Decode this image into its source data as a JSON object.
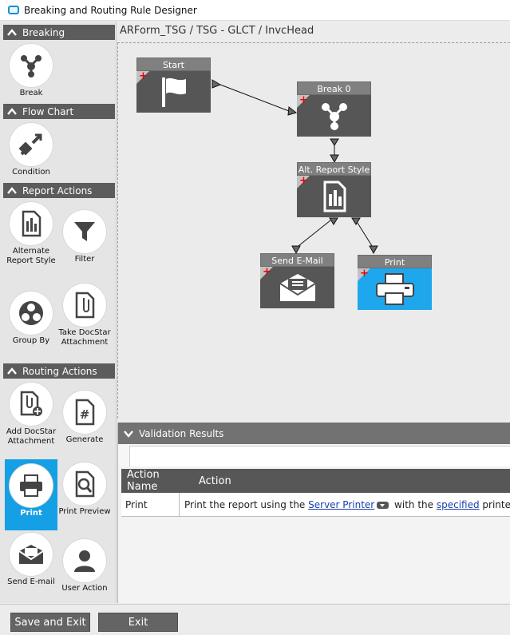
{
  "window": {
    "title": "Breaking and Routing Rule Designer"
  },
  "breadcrumb": "ARForm_TSG / TSG - GLCT / InvcHead",
  "sections": {
    "breaking": "Breaking",
    "flow_chart": "Flow Chart",
    "report_actions": "Report Actions",
    "routing_actions": "Routing Actions"
  },
  "tools": {
    "break": "Break",
    "condition": "Condition",
    "alternate_report_style": "Alternate Report Style",
    "filter": "Filter",
    "group_by": "Group By",
    "take_docstar_attachment": "Take DocStar Attachment",
    "add_docstar_attachment": "Add DocStar Attachment",
    "generate": "Generate",
    "print": "Print",
    "print_preview": "Print Preview",
    "send_email": "Send E-mail",
    "user_action": "User Action"
  },
  "nodes": {
    "start": "Start",
    "break0": "Break 0",
    "alt_report_style": "Alt. Report Style",
    "send_email": "Send E-Mail",
    "print": "Print"
  },
  "validation": {
    "title": "Validation Results",
    "columns": [
      "Action Name",
      "Action"
    ],
    "rows": [
      {
        "name": "Print",
        "text_before": "Print the report using the ",
        "link1": "Server Printer",
        "text_middle": " with the ",
        "link2": "specified",
        "text_after": " printe"
      }
    ]
  },
  "buttons": {
    "save_exit": "Save and Exit",
    "exit": "Exit"
  },
  "colors": {
    "accent": "#159fe5",
    "section_header": "#5c5c5c",
    "node_body": "#565656",
    "node_header": "#808080",
    "error_plus": "#e00000"
  }
}
